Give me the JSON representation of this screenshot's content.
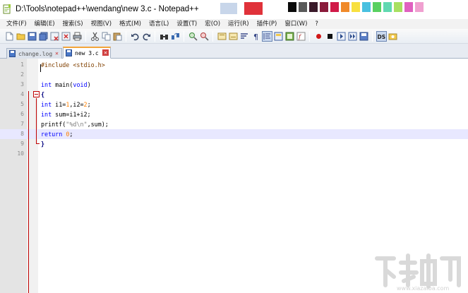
{
  "window": {
    "title": "D:\\Tools\\notepad++\\wendang\\new  3.c - Notepad++"
  },
  "title_swatches": [
    "#0a0a0a",
    "#5a5a5a",
    "#3a1a2a",
    "#8a1a3a",
    "#d01a48",
    "#f08a2a",
    "#f8e040",
    "#48c0e0",
    "#58d060",
    "#60d8b0",
    "#a8e060",
    "#e060c0",
    "#f0a0d0"
  ],
  "menu": {
    "items": [
      {
        "label": "文件(F)"
      },
      {
        "label": "编辑(E)"
      },
      {
        "label": "搜索(S)"
      },
      {
        "label": "视图(V)"
      },
      {
        "label": "格式(M)"
      },
      {
        "label": "语言(L)"
      },
      {
        "label": "设置(T)"
      },
      {
        "label": "宏(O)"
      },
      {
        "label": "运行(R)"
      },
      {
        "label": "插件(P)"
      },
      {
        "label": "窗口(W)"
      },
      {
        "label": "?"
      }
    ]
  },
  "tabs": [
    {
      "label": "change.log",
      "active": false
    },
    {
      "label": "new  3.c",
      "active": true
    }
  ],
  "editor": {
    "current_line": 8,
    "lines": [
      {
        "n": "1"
      },
      {
        "n": "2"
      },
      {
        "n": "3"
      },
      {
        "n": "4"
      },
      {
        "n": "5"
      },
      {
        "n": "6"
      },
      {
        "n": "7"
      },
      {
        "n": "8"
      },
      {
        "n": "9"
      },
      {
        "n": "10"
      }
    ],
    "tokens": {
      "l1": "#include <stdio.h>",
      "l3_kw": "int",
      "l3_rest": " main(",
      "l3_void": "void",
      "l3_end": ")",
      "l4": "{",
      "l5_kw": "int",
      "l5_a": " i1=",
      "l5_n1": "1",
      "l5_b": ",i2=",
      "l5_n2": "2",
      "l5_c": ";",
      "l6_kw": "int",
      "l6_rest": " sum=i1+i2;",
      "l7_a": "printf(",
      "l7_str": "\"%d\\n\"",
      "l7_b": ",sum);",
      "l8_kw": "return",
      "l8_sp": " ",
      "l8_num": "0",
      "l8_end": ";",
      "l9": "}"
    }
  },
  "watermark": {
    "site": "www.xiazaiba.com"
  }
}
